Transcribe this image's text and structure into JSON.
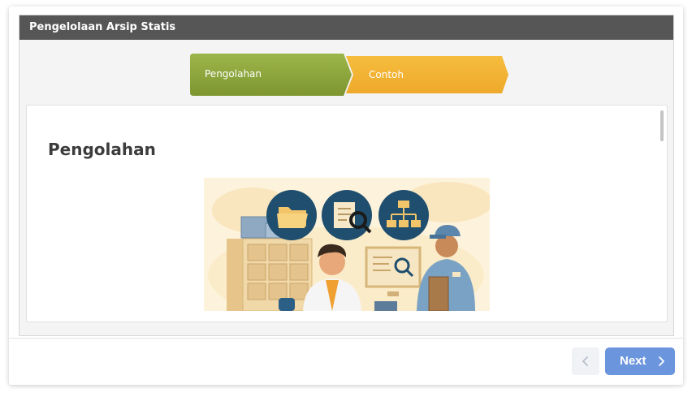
{
  "panel": {
    "title": "Pengelolaan Arsip Statis"
  },
  "steps": [
    {
      "label": "Pengolahan",
      "state": "active",
      "color": "#8fa93a"
    },
    {
      "label": "Contoh",
      "state": "upcoming",
      "color": "#f2b234"
    }
  ],
  "content": {
    "heading": "Pengolahan",
    "illustration": "archive-processing-illustration"
  },
  "footer": {
    "prev_icon": "chevron-left-icon",
    "next_label": "Next",
    "next_icon": "chevron-right-icon",
    "accent": "#6b95dd"
  }
}
